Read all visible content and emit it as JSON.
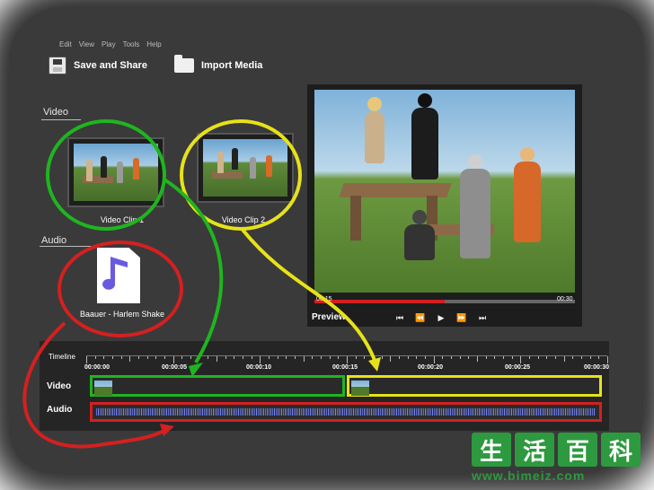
{
  "menu": [
    "Edit",
    "View",
    "Play",
    "Tools",
    "Help"
  ],
  "toolbar": {
    "save_label": "Save and Share",
    "import_label": "Import Media"
  },
  "media": {
    "video_header": "Video",
    "audio_header": "Audio",
    "clips": [
      {
        "label": "Video Clip 1",
        "ring_color": "#1fb51f"
      },
      {
        "label": "Video Clip 2",
        "ring_color": "#e6e21a"
      }
    ],
    "audio_file": {
      "label": "Baauer - Harlem Shake",
      "icon": "music-note-icon",
      "ring_color": "#d42020"
    }
  },
  "preview": {
    "title": "Preview",
    "time_current": "00:15",
    "time_total": "00:30",
    "progress": 0.5,
    "controls": [
      {
        "name": "skip-start-button",
        "glyph": "⏮"
      },
      {
        "name": "rewind-button",
        "glyph": "⏪"
      },
      {
        "name": "play-button",
        "glyph": "▶"
      },
      {
        "name": "fast-forward-button",
        "glyph": "⏩"
      },
      {
        "name": "skip-end-button",
        "glyph": "⏭"
      }
    ]
  },
  "timeline": {
    "label": "Timeline",
    "times": [
      "00:00:00",
      "00:00:05",
      "00:00:10",
      "00:00:15",
      "00:00:20",
      "00:00:25",
      "00:00:30"
    ],
    "tracks": {
      "video": "Video",
      "audio": "Audio"
    }
  },
  "watermark": {
    "chars": [
      "生",
      "活",
      "百",
      "科"
    ],
    "url": "www.bimeiz.com"
  },
  "colors": {
    "green": "#1fb51f",
    "yellow": "#e6e21a",
    "red": "#d42020",
    "wave": "#5b6ed0"
  }
}
